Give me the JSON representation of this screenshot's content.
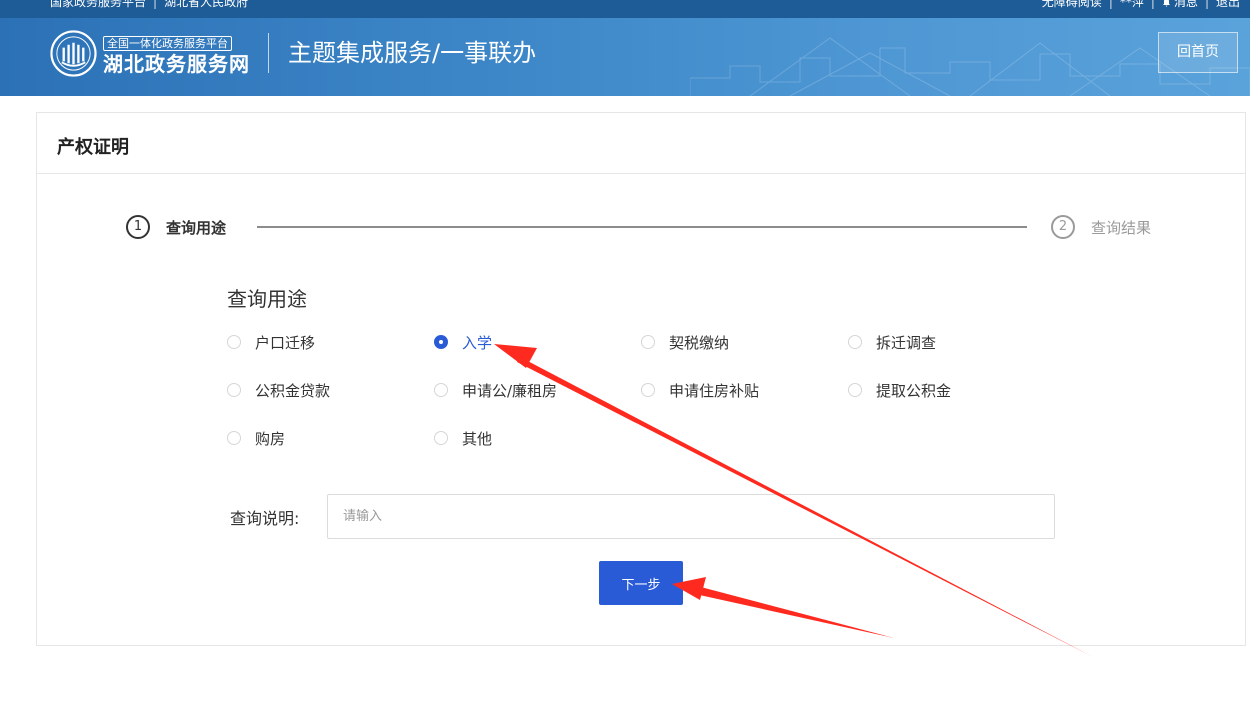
{
  "topbar": {
    "left_links": [
      "国家政务服务平台",
      "湖北省人民政府"
    ],
    "right_links": [
      "无障碍阅读",
      "**萍",
      "消息",
      "退出"
    ]
  },
  "header": {
    "brand_small": "全国一体化政务服务平台",
    "brand_big": "湖北政务服务网",
    "page_heading": "主题集成服务/一事联办",
    "home_button": "回首页"
  },
  "panel": {
    "title": "产权证明",
    "steps": [
      {
        "num": "1",
        "label": "查询用途",
        "state": "active"
      },
      {
        "num": "2",
        "label": "查询结果",
        "state": "inactive"
      }
    ],
    "section_title": "查询用途",
    "options": [
      "户口迁移",
      "入学",
      "契税缴纳",
      "拆迁调查",
      "公积金贷款",
      "申请公/廉租房",
      "申请住房补贴",
      "提取公积金",
      "购房",
      "其他"
    ],
    "selected_option": "入学",
    "query_label": "查询说明:",
    "query_placeholder": "请输入",
    "next_button": "下一步"
  },
  "colors": {
    "accent": "#2a5bd7",
    "header_blue": "#3d87c8",
    "annotation_arrow": "#ff2a1f"
  }
}
